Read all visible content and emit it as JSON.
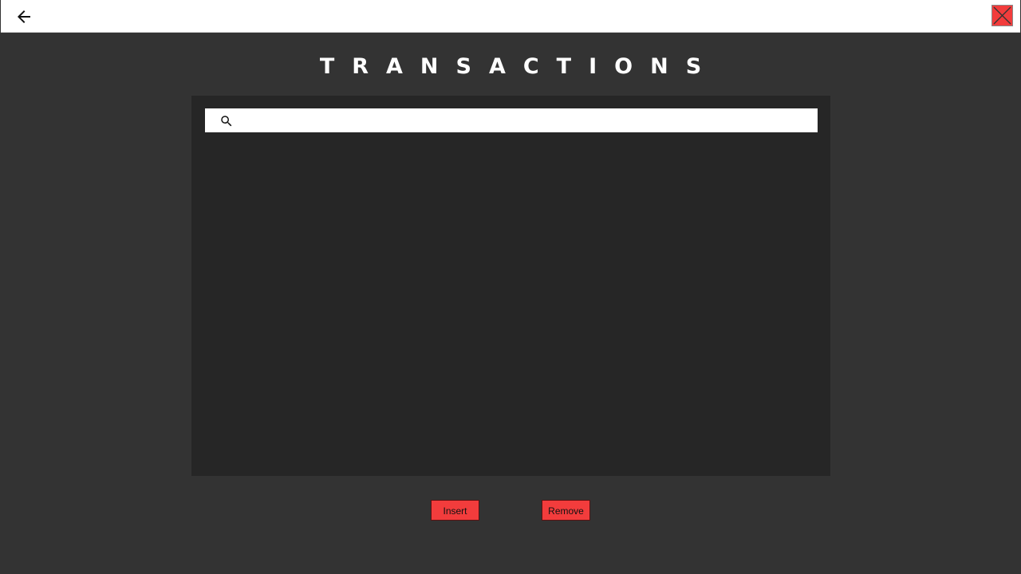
{
  "header": {
    "back_icon": "arrow-left-icon",
    "close_icon": "close-x-icon",
    "close_color": "#f23c3c"
  },
  "page": {
    "title": "TRANSACTIONS"
  },
  "search": {
    "icon": "search-icon",
    "value": "",
    "placeholder": ""
  },
  "actions": {
    "insert_label": "Insert",
    "remove_label": "Remove",
    "button_color": "#f23c3c"
  },
  "colors": {
    "background": "#333333",
    "panel": "#262626",
    "title": "#ffffff"
  }
}
